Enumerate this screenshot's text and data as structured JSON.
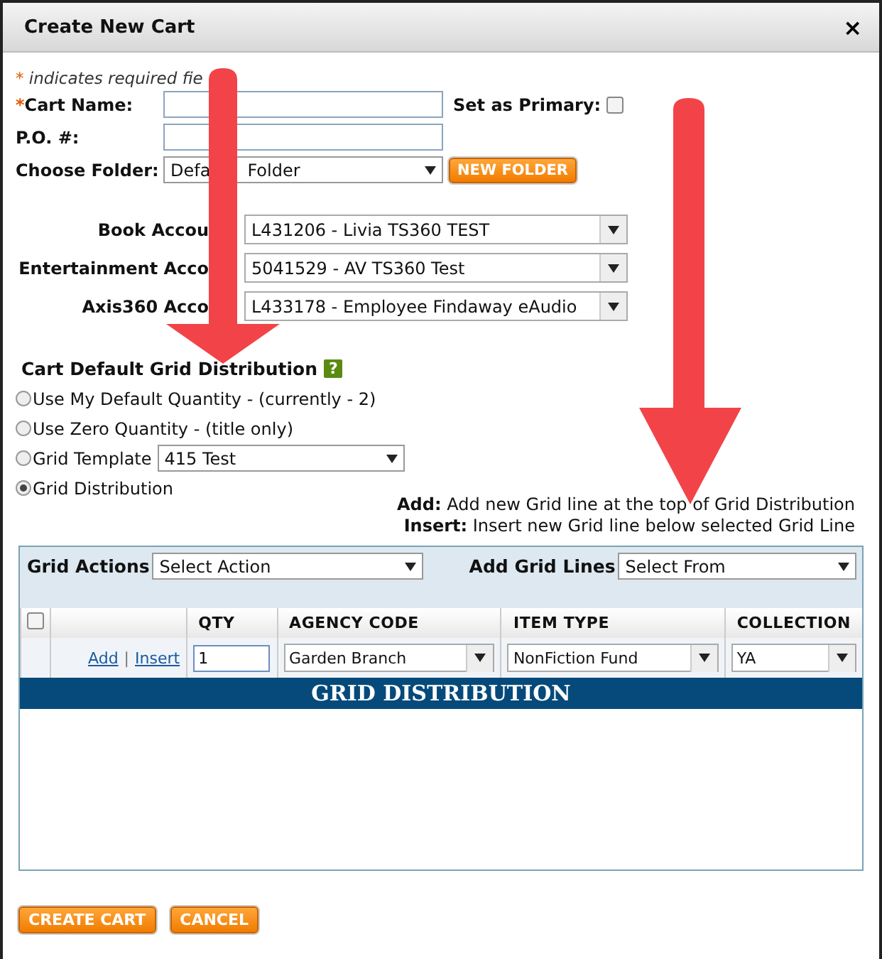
{
  "window": {
    "title": "Create New Cart",
    "close": "×"
  },
  "required_note": {
    "mark": "*",
    "text": "indicates required fie"
  },
  "fields": [
    {
      "label": "Cart Name:",
      "required": true
    },
    {
      "label": "P.O. #:",
      "required": false
    }
  ],
  "set_primary": {
    "label": "Set as Primary:",
    "checked": false
  },
  "folder": {
    "label": "Choose Folder:",
    "value_parts": [
      "Defa",
      "Folder"
    ],
    "button": "NEW FOLDER"
  },
  "accounts": [
    {
      "label": "Book Accou",
      "value": "L431206 - Livia TS360 TEST"
    },
    {
      "label": "Entertainment Acco",
      "value": "5041529 - AV TS360 Test"
    },
    {
      "label": "Axis360 Acco",
      "value": "L433178 - Employee Findaway eAudio"
    }
  ],
  "distribution": {
    "title": "Cart Default Grid Distribution",
    "help": "?",
    "options": [
      {
        "label": "Use My Default Quantity - (currently - 2)",
        "selected": false
      },
      {
        "label": "Use Zero Quantity - (title only)",
        "selected": false
      },
      {
        "label": "Grid Template",
        "selected": false,
        "value": "415 Test"
      },
      {
        "label": "Grid Distribution",
        "selected": true
      }
    ]
  },
  "hints": [
    {
      "term": "Add:",
      "text": "Add new Grid line at the top of Grid Distribution"
    },
    {
      "term": "Insert:",
      "text": "Insert new Grid line below selected Grid Line"
    }
  ],
  "grid": {
    "actions_label": "Grid Actions",
    "actions_value": "Select Action",
    "lines_label": "Add Grid Lines",
    "lines_value": "Select From",
    "select_all": false,
    "columns": [
      "QTY",
      "AGENCY CODE",
      "ITEM TYPE",
      "COLLECTION"
    ],
    "row": {
      "links": [
        "Add",
        "Insert"
      ],
      "separator": "|",
      "qty": "1",
      "agency": "Garden Branch",
      "item_type": "NonFiction Fund",
      "collection": "YA"
    },
    "banner": "GRID DISTRIBUTION"
  },
  "buttons": [
    "CREATE CART",
    "CANCEL"
  ]
}
